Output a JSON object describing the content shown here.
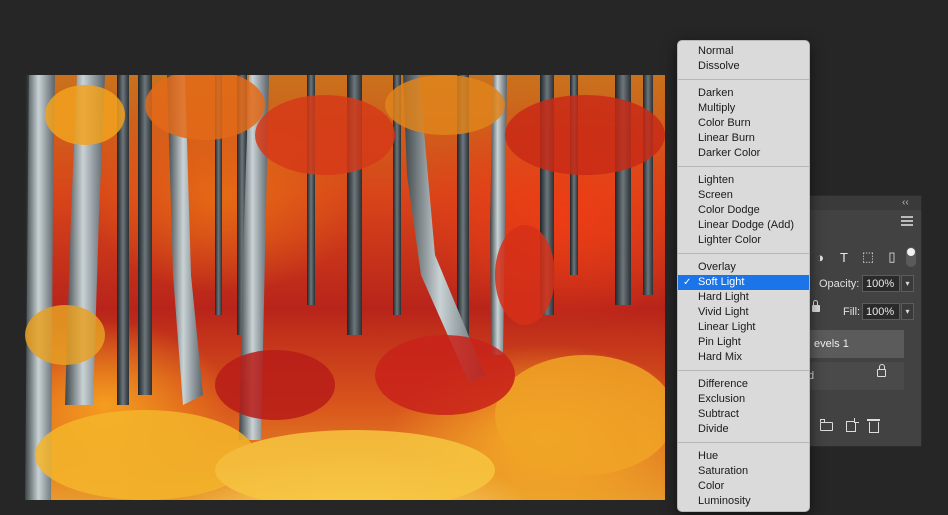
{
  "blend_menu": {
    "selected": "Soft Light",
    "groups": [
      [
        "Normal",
        "Dissolve"
      ],
      [
        "Darken",
        "Multiply",
        "Color Burn",
        "Linear Burn",
        "Darker Color"
      ],
      [
        "Lighten",
        "Screen",
        "Color Dodge",
        "Linear Dodge (Add)",
        "Lighter Color"
      ],
      [
        "Overlay",
        "Soft Light",
        "Hard Light",
        "Vivid Light",
        "Linear Light",
        "Pin Light",
        "Hard Mix"
      ],
      [
        "Difference",
        "Exclusion",
        "Subtract",
        "Divide"
      ],
      [
        "Hue",
        "Saturation",
        "Color",
        "Luminosity"
      ]
    ]
  },
  "layers_panel": {
    "opacity_label": "Opacity:",
    "opacity_value": "100%",
    "fill_label": "Fill:",
    "fill_value": "100%",
    "layer_1_name": "evels 1",
    "layer_2_name": "d",
    "filter_text_icon": "T",
    "collapse_glyph": "‹‹"
  },
  "colors": {
    "menu_highlight": "#1b74e8",
    "app_background": "#262626",
    "panel_background": "#424242"
  },
  "canvas": {
    "description_icon": "autumn-forest-image"
  }
}
